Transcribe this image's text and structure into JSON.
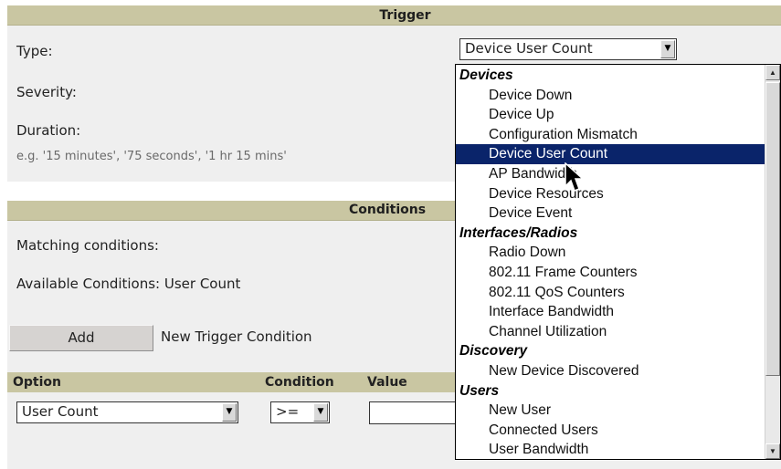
{
  "trigger": {
    "header": "Trigger",
    "type_label": "Type:",
    "severity_label": "Severity:",
    "duration_label": "Duration:",
    "duration_hint": "e.g. '15 minutes', '75 seconds', '1 hr 15 mins'",
    "type_value": "Device User Count"
  },
  "conditions": {
    "header": "Conditions",
    "matching_label": "Matching conditions:",
    "available_label": "Available Conditions: User Count",
    "add_button": "Add",
    "add_caption": "New Trigger Condition",
    "table_headers": [
      "Option",
      "Condition",
      "Value"
    ],
    "row": {
      "option": "User Count",
      "condition": ">="
    }
  },
  "dropdown": {
    "groups": [
      {
        "label": "Devices",
        "items": [
          "Device Down",
          "Device Up",
          "Configuration Mismatch",
          "Device User Count",
          "AP Bandwidth",
          "Device Resources",
          "Device Event"
        ]
      },
      {
        "label": "Interfaces/Radios",
        "items": [
          "Radio Down",
          "802.11 Frame Counters",
          "802.11 QoS Counters",
          "Interface Bandwidth",
          "Channel Utilization"
        ]
      },
      {
        "label": "Discovery",
        "items": [
          "New Device Discovered"
        ]
      },
      {
        "label": "Users",
        "items": [
          "New User",
          "Connected Users",
          "User Bandwidth"
        ]
      }
    ],
    "selected": "Device User Count"
  },
  "colors": {
    "header": "#c9c6a2",
    "panel": "#efefef",
    "highlight": "#0a246a"
  }
}
